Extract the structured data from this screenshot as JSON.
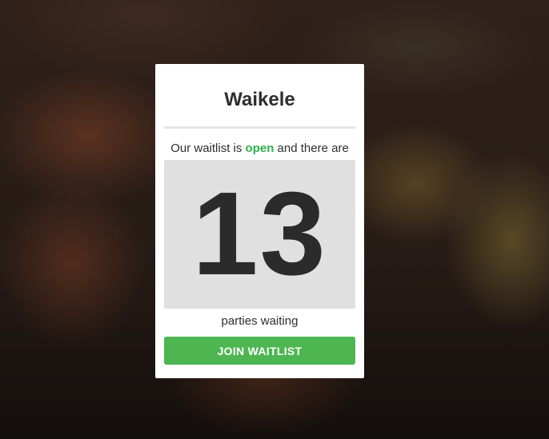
{
  "location": {
    "name": "Waikele"
  },
  "status": {
    "prefix": "Our waitlist is ",
    "state": "open",
    "suffix": " and there are"
  },
  "waitlist": {
    "count": "13",
    "count_label": "parties waiting"
  },
  "actions": {
    "join_label": "JOIN WAITLIST"
  },
  "colors": {
    "open_status": "#2bb34a",
    "button": "#4db651",
    "count_box": "#e0e0e0"
  }
}
